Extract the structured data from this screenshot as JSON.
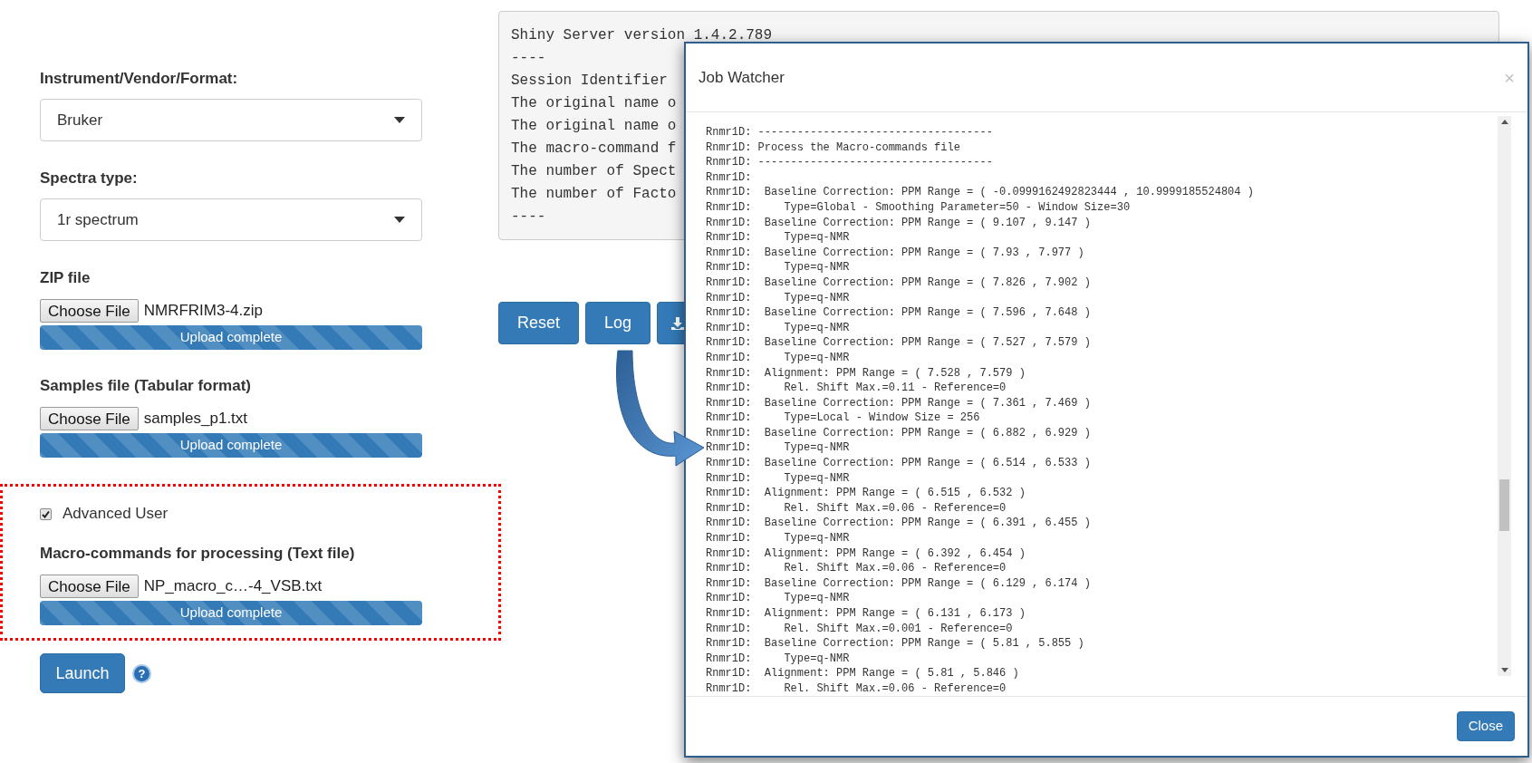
{
  "form": {
    "fields": [
      {
        "kind": "select",
        "label": "Instrument/Vendor/Format:",
        "value": "Bruker"
      },
      {
        "kind": "select",
        "label": "Spectra type:",
        "value": "1r spectrum"
      },
      {
        "kind": "file",
        "label": "ZIP file",
        "button": "Choose File",
        "filename": "NMRFRIM3-4.zip",
        "progress_text": "Upload complete",
        "level": 1
      },
      {
        "kind": "file",
        "label": "Samples file (Tabular format)",
        "button": "Choose File",
        "filename": "samples_p1.txt",
        "progress_text": "Upload complete",
        "level": 1
      }
    ],
    "advanced": {
      "checkbox": {
        "label": "Advanced User",
        "checked": true
      },
      "macro_file": {
        "label": "Macro-commands for processing (Text file)",
        "button": "Choose File",
        "filename": "NP_macro_c…-4_VSB.txt",
        "progress_text": "Upload complete",
        "level": 1
      }
    },
    "launch_button": "Launch",
    "help_icon": "?"
  },
  "console": {
    "lines": [
      "Shiny Server version 1.4.2.789",
      "----",
      "Session Identifier",
      "The original name o",
      "The original name o",
      "The macro-command f",
      "The number of Spect",
      "The number of Facto",
      "----"
    ]
  },
  "buttons": [
    {
      "kind": "text",
      "label": "Reset"
    },
    {
      "kind": "text",
      "label": "Log"
    },
    {
      "kind": "download"
    }
  ],
  "modal": {
    "title": "Job Watcher",
    "close_icon": "×",
    "log_lines": [
      "Rnmr1D: ------------------------------------",
      "Rnmr1D: Process the Macro-commands file",
      "Rnmr1D: ------------------------------------",
      "Rnmr1D:",
      "Rnmr1D:  Baseline Correction: PPM Range = ( -0.0999162492823444 , 10.9999185524804 )",
      "Rnmr1D:     Type=Global - Smoothing Parameter=50 - Window Size=30",
      "Rnmr1D:  Baseline Correction: PPM Range = ( 9.107 , 9.147 )",
      "Rnmr1D:     Type=q-NMR",
      "Rnmr1D:  Baseline Correction: PPM Range = ( 7.93 , 7.977 )",
      "Rnmr1D:     Type=q-NMR",
      "Rnmr1D:  Baseline Correction: PPM Range = ( 7.826 , 7.902 )",
      "Rnmr1D:     Type=q-NMR",
      "Rnmr1D:  Baseline Correction: PPM Range = ( 7.596 , 7.648 )",
      "Rnmr1D:     Type=q-NMR",
      "Rnmr1D:  Baseline Correction: PPM Range = ( 7.527 , 7.579 )",
      "Rnmr1D:     Type=q-NMR",
      "Rnmr1D:  Alignment: PPM Range = ( 7.528 , 7.579 )",
      "Rnmr1D:     Rel. Shift Max.=0.11 - Reference=0",
      "Rnmr1D:  Baseline Correction: PPM Range = ( 7.361 , 7.469 )",
      "Rnmr1D:     Type=Local - Window Size = 256",
      "Rnmr1D:  Baseline Correction: PPM Range = ( 6.882 , 6.929 )",
      "Rnmr1D:     Type=q-NMR",
      "Rnmr1D:  Baseline Correction: PPM Range = ( 6.514 , 6.533 )",
      "Rnmr1D:     Type=q-NMR",
      "Rnmr1D:  Alignment: PPM Range = ( 6.515 , 6.532 )",
      "Rnmr1D:     Rel. Shift Max.=0.06 - Reference=0",
      "Rnmr1D:  Baseline Correction: PPM Range = ( 6.391 , 6.455 )",
      "Rnmr1D:     Type=q-NMR",
      "Rnmr1D:  Alignment: PPM Range = ( 6.392 , 6.454 )",
      "Rnmr1D:     Rel. Shift Max.=0.06 - Reference=0",
      "Rnmr1D:  Baseline Correction: PPM Range = ( 6.129 , 6.174 )",
      "Rnmr1D:     Type=q-NMR",
      "Rnmr1D:  Alignment: PPM Range = ( 6.131 , 6.173 )",
      "Rnmr1D:     Rel. Shift Max.=0.001 - Reference=0",
      "Rnmr1D:  Baseline Correction: PPM Range = ( 5.81 , 5.855 )",
      "Rnmr1D:     Type=q-NMR",
      "Rnmr1D:  Alignment: PPM Range = ( 5.81 , 5.846 )",
      "Rnmr1D:     Rel. Shift Max.=0.06 - Reference=0"
    ],
    "close_button": "Close"
  }
}
